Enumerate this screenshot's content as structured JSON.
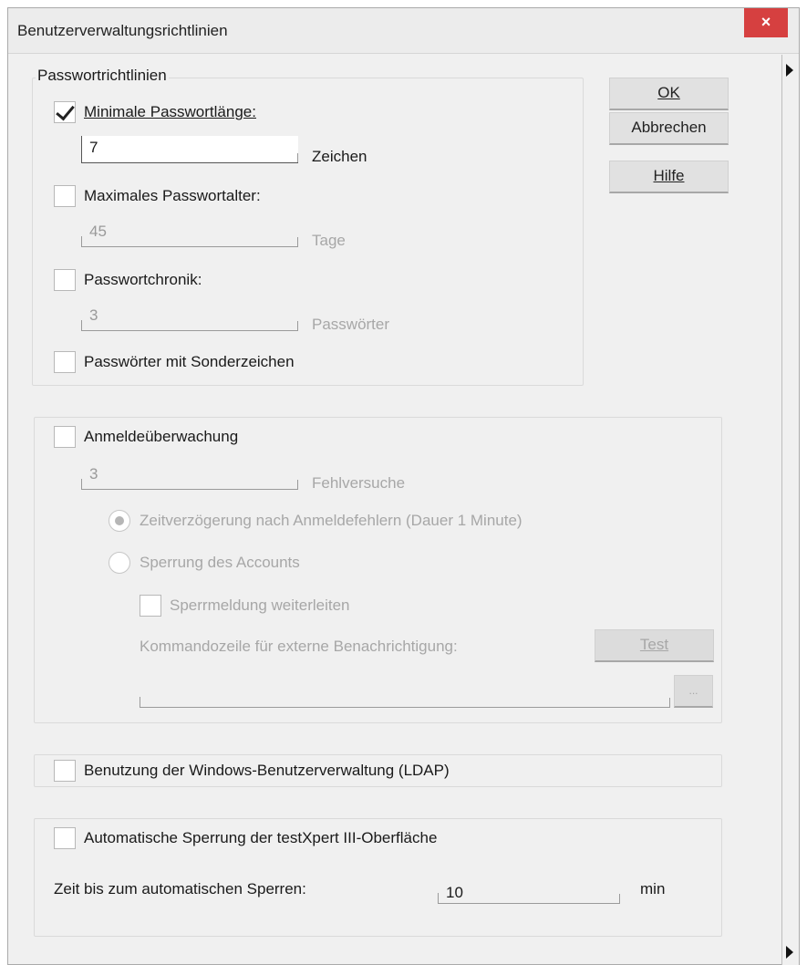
{
  "window": {
    "title": "Benutzerverwaltungsrichtlinien",
    "close_label": "×"
  },
  "buttons": {
    "ok": "OK",
    "cancel": "Abbrechen",
    "help": "Hilfe",
    "test": "Test",
    "browse": "..."
  },
  "password_policy": {
    "group_title": "Passwortrichtlinien",
    "min_length": {
      "label": "Minimale Passwortlänge:",
      "checked": true,
      "value": "7",
      "unit": "Zeichen"
    },
    "max_age": {
      "label": "Maximales Passwortalter:",
      "checked": false,
      "value": "45",
      "unit": "Tage"
    },
    "history": {
      "label": "Passwortchronik:",
      "checked": false,
      "value": "3",
      "unit": "Passwörter"
    },
    "special_chars": {
      "label": "Passwörter mit Sonderzeichen",
      "checked": false
    }
  },
  "login_monitoring": {
    "label": "Anmeldeüberwachung",
    "checked": false,
    "attempts_value": "3",
    "attempts_unit": "Fehlversuche",
    "delay_option": {
      "label": "Zeitverzögerung nach Anmeldefehlern (Dauer 1 Minute)",
      "selected": true
    },
    "lock_option": {
      "label": "Sperrung des Accounts",
      "selected": false
    },
    "forward_lock_msg": {
      "label": "Sperrmeldung weiterleiten",
      "checked": false
    },
    "command_line_label": "Kommandozeile für externe Benachrichtigung:",
    "command_line_value": ""
  },
  "ldap": {
    "label": "Benutzung der Windows-Benutzerverwaltung (LDAP)",
    "checked": false
  },
  "auto_lock": {
    "label": "Automatische Sperrung der testXpert III-Oberfläche",
    "checked": false,
    "time_label": "Zeit bis zum automatischen Sperren:",
    "time_value": "10",
    "time_unit": "min"
  }
}
